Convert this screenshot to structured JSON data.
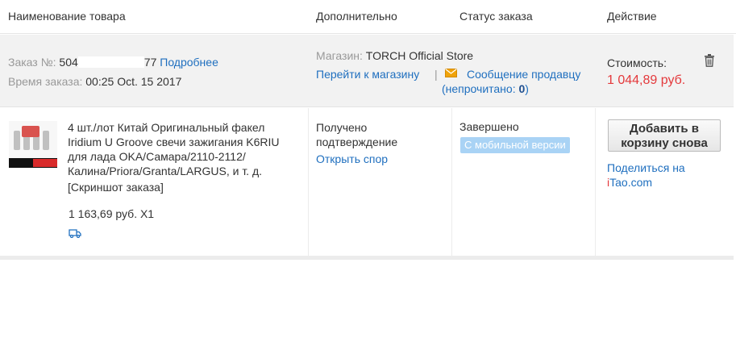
{
  "header": {
    "product_name": "Наименование товара",
    "additional": "Дополнительно",
    "order_status": "Статус заказа",
    "action": "Действие"
  },
  "order": {
    "order_no_label": "Заказ №:",
    "order_no_prefix": "504",
    "order_no_suffix": "77",
    "details_link": "Подробнее",
    "time_label": "Время заказа:",
    "time_value": "00:25 Oct. 15 2017",
    "store_label": "Магазин:",
    "store_name": "TORCH Official Store",
    "go_to_store": "Перейти к магазину",
    "separator": "|",
    "message_seller": "Сообщение продавцу",
    "unread_open": "(непрочитано: ",
    "unread_count": "0",
    "unread_close": ")",
    "cost_label": "Стоимость:",
    "cost_value": "1 044,89 руб."
  },
  "item": {
    "title_lines": [
      "4 шт./лот Китай Оригинальный факел",
      "Iridium U Groove свечи зажигания K6RIU",
      "для лада OKA/Самара/2110-2112/",
      "Калина/Priora/Granta/LARGUS, и т. д."
    ],
    "snapshot": "[Скриншот заказа]",
    "price_qty": "1 163,69 руб. X1",
    "additional_line1": "Получено",
    "additional_line2": "подтверждение",
    "open_dispute": "Открыть спор",
    "status": "Завершено",
    "mobile_badge": "С мобильной версии",
    "add_to_cart_line1": "Добавить в",
    "add_to_cart_line2": "корзину снова",
    "share_line1": "Поделиться на",
    "share_brand_i": "i",
    "share_brand_tao": "Tao",
    "share_brand_com": ".com"
  },
  "icons": {
    "trash": "trash-icon",
    "mail": "mail-icon",
    "truck": "truck-icon"
  },
  "colors": {
    "link": "#1f6fbf",
    "price": "#e4393c",
    "badge": "#a9d3f5",
    "mail_icon": "#f0a30a",
    "summary_bg": "#f2f2f2"
  }
}
